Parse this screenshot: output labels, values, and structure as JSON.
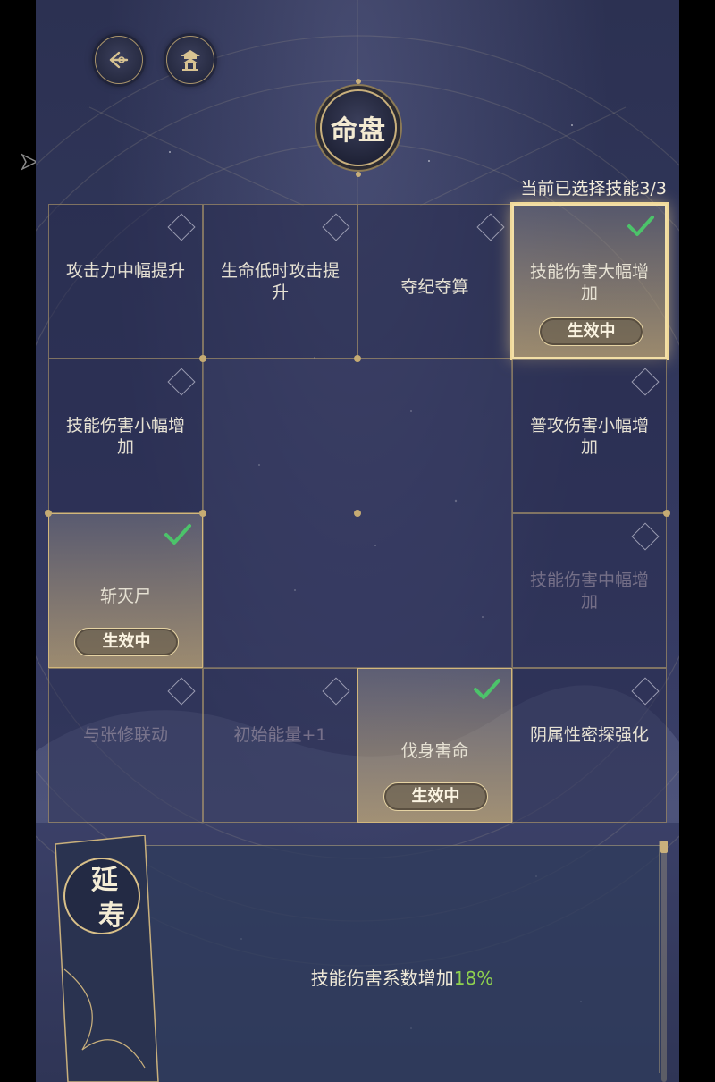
{
  "header": {
    "back_icon": "back-arrow-icon",
    "home_icon": "pavilion-icon",
    "title": "命盘",
    "selected_count": "当前已选择技能3/3"
  },
  "skills": [
    {
      "label": "攻击力中幅提升",
      "checked": false,
      "active": false,
      "dim": false,
      "status": ""
    },
    {
      "label": "生命低时攻击提升",
      "checked": false,
      "active": false,
      "dim": false,
      "status": ""
    },
    {
      "label": "夺纪夺算",
      "checked": false,
      "active": false,
      "dim": false,
      "status": ""
    },
    {
      "label": "技能伤害大幅增加",
      "checked": true,
      "active": true,
      "dim": false,
      "status": "生效中"
    },
    {
      "label": "技能伤害小幅增加",
      "checked": false,
      "active": false,
      "dim": false,
      "status": ""
    },
    {
      "label": "普攻伤害小幅增加",
      "checked": false,
      "active": false,
      "dim": false,
      "status": ""
    },
    {
      "label": "斩灭尸",
      "checked": true,
      "active": true,
      "dim": false,
      "status": "生效中"
    },
    {
      "label": "技能伤害中幅增加",
      "checked": false,
      "active": false,
      "dim": true,
      "status": ""
    },
    {
      "label": "与张修联动",
      "checked": false,
      "active": false,
      "dim": true,
      "status": ""
    },
    {
      "label": "初始能量+1",
      "checked": false,
      "active": false,
      "dim": true,
      "status": ""
    },
    {
      "label": "伐身害命",
      "checked": true,
      "active": true,
      "dim": false,
      "status": "生效中"
    },
    {
      "label": "阴属性密探强化",
      "checked": false,
      "active": false,
      "dim": false,
      "status": ""
    }
  ],
  "detail": {
    "banner_title": "延寿",
    "description_prefix": "技能伤害系数增加",
    "description_value": "18%"
  },
  "colors": {
    "accent_gold": "#c9b07c",
    "highlight_green": "#8fd14f",
    "check_green": "#4cc36a"
  }
}
